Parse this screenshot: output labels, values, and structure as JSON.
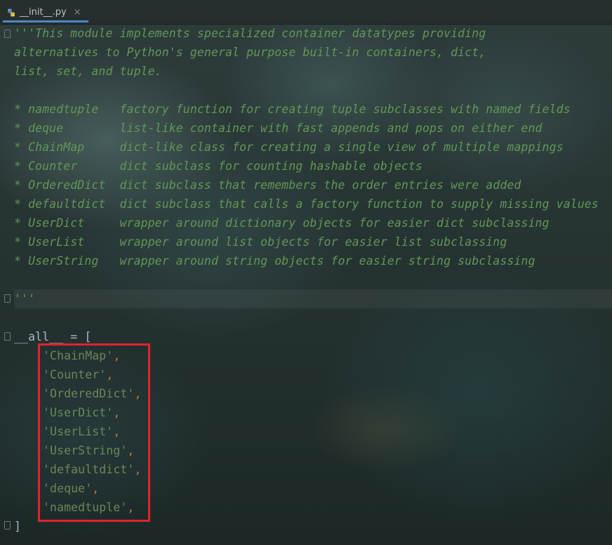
{
  "tab": {
    "filename": "__init__.py",
    "close_glyph": "×"
  },
  "docstring": {
    "line1": "'''This module implements specialized container datatypes providing",
    "line2": "alternatives to Python's general purpose built-in containers, dict,",
    "line3": "list, set, and tuple.",
    "items": [
      "* namedtuple   factory function for creating tuple subclasses with named fields",
      "* deque        list-like container with fast appends and pops on either end",
      "* ChainMap     dict-like class for creating a single view of multiple mappings",
      "* Counter      dict subclass for counting hashable objects",
      "* OrderedDict  dict subclass that remembers the order entries were added",
      "* defaultdict  dict subclass that calls a factory function to supply missing values",
      "* UserDict     wrapper around dictionary objects for easier dict subclassing",
      "* UserList     wrapper around list objects for easier list subclassing",
      "* UserString   wrapper around string objects for easier string subclassing"
    ],
    "close": "'''"
  },
  "all_decl": {
    "open": "__all__ = [",
    "entries": [
      "'ChainMap'",
      "'Counter'",
      "'OrderedDict'",
      "'UserDict'",
      "'UserList'",
      "'UserString'",
      "'defaultdict'",
      "'deque'",
      "'namedtuple'"
    ],
    "comma": ",",
    "close": "]"
  },
  "colors": {
    "docstring": "#629755",
    "string": "#6a8759",
    "keyword_punct": "#cc7832",
    "code": "#a9b7c6",
    "highlight_box": "#e0242b",
    "tab_underline": "#4a88c7"
  },
  "icons": {
    "tab_file": "python-file-icon",
    "fold_markers": "code-fold-icon"
  }
}
